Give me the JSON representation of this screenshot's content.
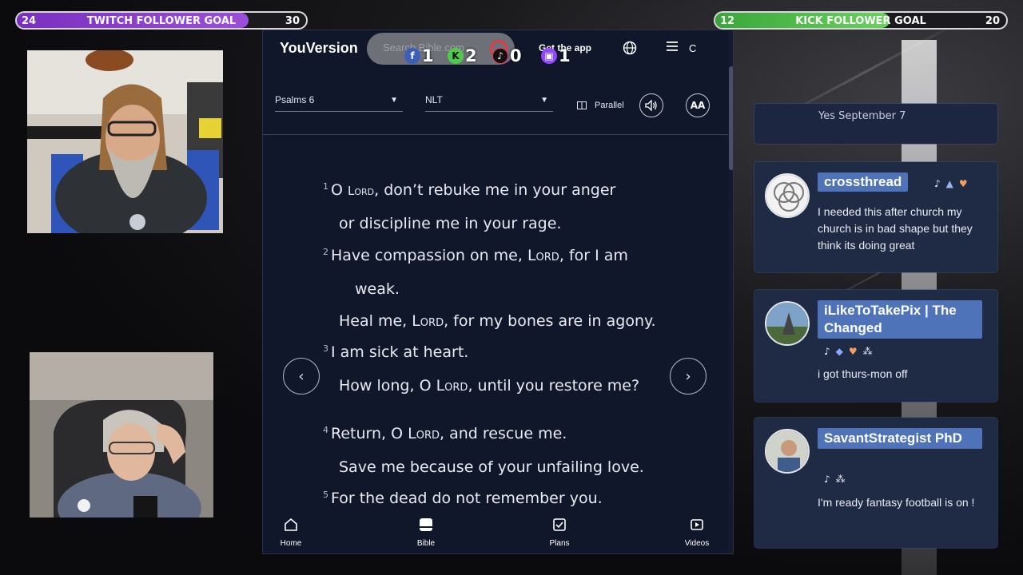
{
  "goals": {
    "twitch": {
      "current": "24",
      "title": "TWITCH FOLLOWER GOAL",
      "target": "30",
      "progress": 0.8
    },
    "kick": {
      "current": "12",
      "title": "KICK FOLLOWER GOAL",
      "target": "20",
      "progress": 0.6
    }
  },
  "social_counts": {
    "facebook": "1",
    "kick": "2",
    "tiktok": "0",
    "twitch": "1"
  },
  "app": {
    "brand": "YouVersion",
    "search_placeholder": "Search Bible.com",
    "get_app": "Get the app",
    "avatar_initial": "C",
    "book_select": "Psalms 6",
    "version_select": "NLT",
    "parallel_label": "Parallel",
    "font_button": "AA",
    "verses": [
      {
        "num": "1",
        "pre": "O ",
        "lord": "Lord",
        "post": ", don’t rebuke me in your anger"
      },
      {
        "num": "",
        "pre": "or discipline me in your rage.",
        "lord": "",
        "post": ""
      },
      {
        "num": "2",
        "pre": "Have compassion on me, ",
        "lord": "Lord",
        "post": ", for I am"
      },
      {
        "num": "",
        "pre": "weak.",
        "lord": "",
        "post": ""
      },
      {
        "num": "",
        "pre": "Heal me, ",
        "lord": "Lord",
        "post": ", for my bones are in agony."
      },
      {
        "num": "3",
        "pre": "I am sick at heart.",
        "lord": "",
        "post": ""
      },
      {
        "num": "",
        "pre": "How long, O ",
        "lord": "Lord",
        "post": ", until you restore me?"
      },
      {
        "num": "4",
        "pre": "Return, O ",
        "lord": "Lord",
        "post": ", and rescue me."
      },
      {
        "num": "",
        "pre": "Save me because of your unfailing love.",
        "lord": "",
        "post": ""
      },
      {
        "num": "5",
        "pre": "For the dead do not remember you.",
        "lord": "",
        "post": ""
      }
    ],
    "bottom_nav": {
      "home": "Home",
      "bible": "Bible",
      "plans": "Plans",
      "videos": "Videos"
    }
  },
  "chat": {
    "previous_tail": "Yes September 7",
    "messages": [
      {
        "user": "crossthread",
        "text": "I needed this after church my church is in bad shape but they think its doing great"
      },
      {
        "user": "iLikeToTakePix | The Changed",
        "text": "i got thurs-mon off"
      },
      {
        "user": "SavantStrategist PhD",
        "text": "I'm ready fantasy football is on !"
      }
    ]
  },
  "colors": {
    "twitch": "#9146ff",
    "kick": "#53fc18",
    "app_bg": "#10172a",
    "chat_name_bg": "#4f73b8"
  }
}
